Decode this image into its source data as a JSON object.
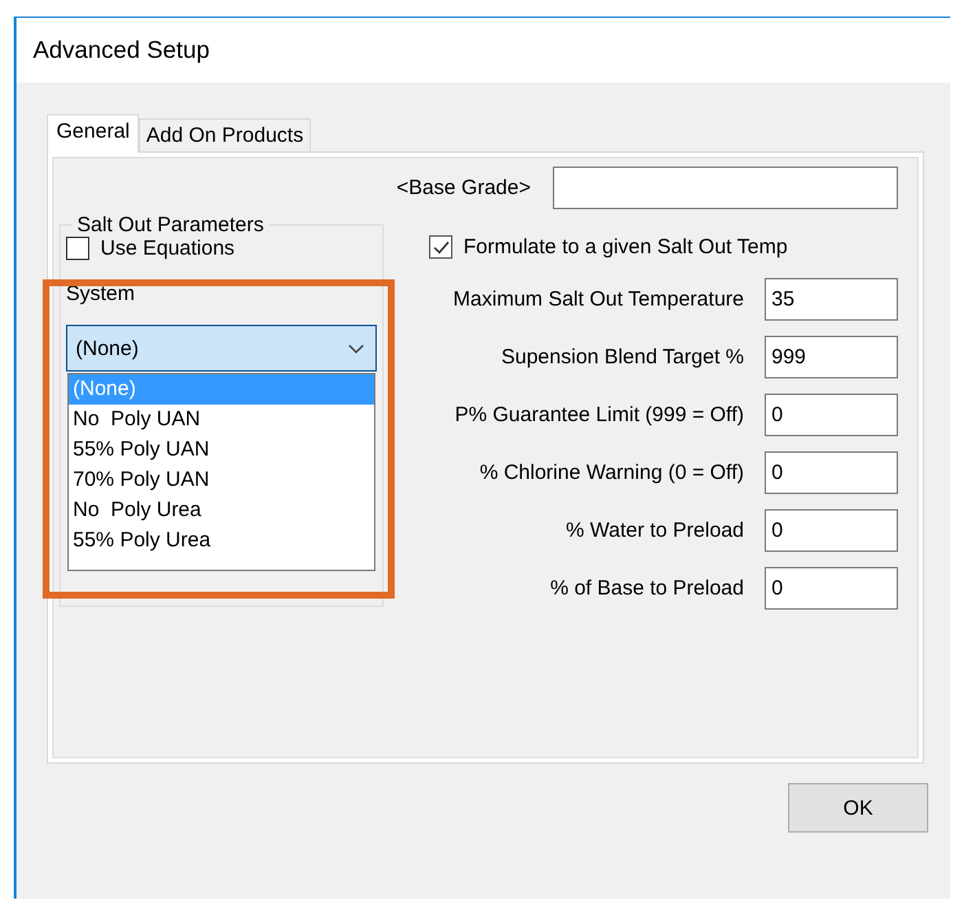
{
  "window": {
    "title": "Advanced Setup"
  },
  "tabs": [
    {
      "label": "General",
      "selected": true
    },
    {
      "label": "Add On Products",
      "selected": false
    }
  ],
  "base_grade": {
    "label": "<Base Grade>"
  },
  "salt_out": {
    "title": "Salt Out Parameters",
    "use_equations": {
      "label": "Use Equations",
      "checked": false
    },
    "system": {
      "label": "System",
      "value": "(None)",
      "highlighted": true,
      "expanded": true,
      "options": [
        {
          "label": "(None)",
          "selected": true
        },
        {
          "label": "No  Poly UAN",
          "selected": false
        },
        {
          "label": "55% Poly UAN",
          "selected": false
        },
        {
          "label": "70% Poly UAN",
          "selected": false
        },
        {
          "label": "No  Poly Urea",
          "selected": false
        },
        {
          "label": "55% Poly Urea",
          "selected": false
        }
      ]
    }
  },
  "formulate": {
    "label": "Formulate to a given Salt Out Temp",
    "checked": true
  },
  "fields": [
    {
      "label": "Maximum Salt Out Temperature",
      "value": "35"
    },
    {
      "label": "Supension Blend Target %",
      "value": "999"
    },
    {
      "label": "P% Guarantee Limit (999 = Off)",
      "value": "0"
    },
    {
      "label": "% Chlorine Warning (0 = Off)",
      "value": "0"
    },
    {
      "label": "% Water to Preload",
      "value": "0"
    },
    {
      "label": "% of Base to Preload",
      "value": "0"
    }
  ],
  "buttons": [
    "OK"
  ]
}
